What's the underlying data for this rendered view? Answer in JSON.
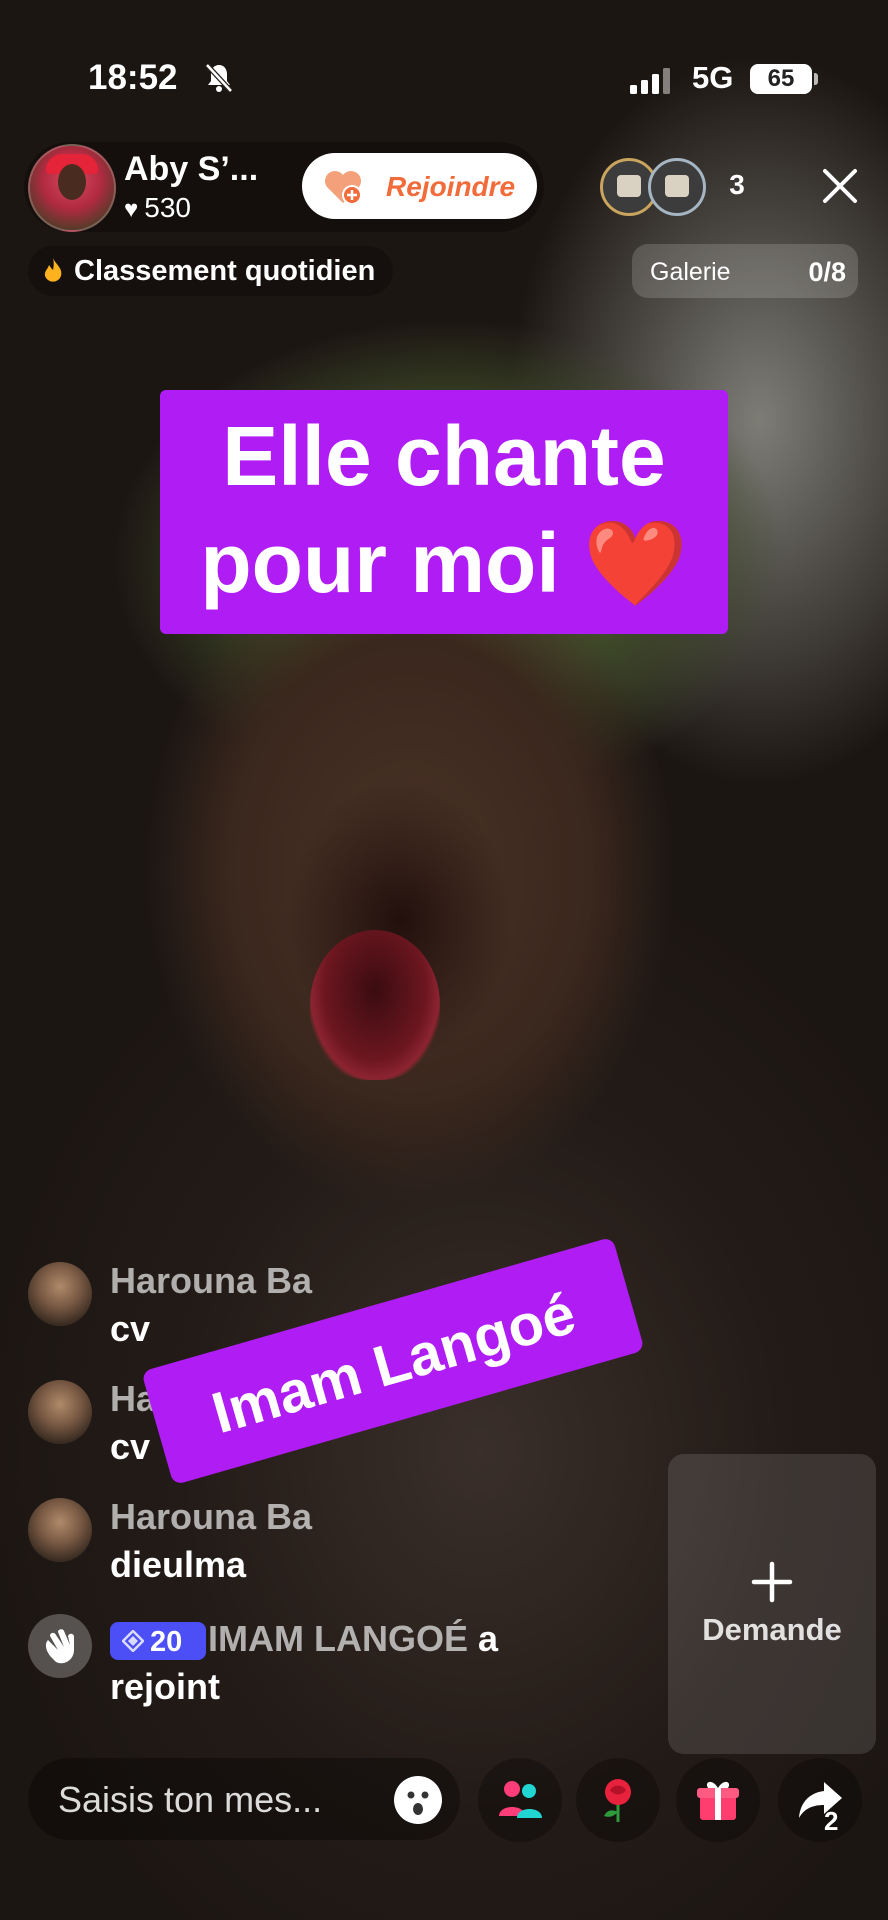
{
  "status_bar": {
    "time": "18:52",
    "network": "5G",
    "battery": "65"
  },
  "host": {
    "name": "Aby S’...",
    "likes": "530",
    "join_label": "Rejoindre"
  },
  "viewers": {
    "count": "3"
  },
  "ranking": {
    "label": "Classement quotidien"
  },
  "gallery": {
    "label": "Galerie",
    "value": "0/8"
  },
  "captions": {
    "main_line1": "Elle chante",
    "main_line2": "pour moi ❤️",
    "secondary": "Imam Langoé"
  },
  "comments": [
    {
      "name": "Harouna Ba",
      "text": "cv"
    },
    {
      "name": "Ha",
      "text": "cv"
    },
    {
      "name": "Harouna Ba",
      "text": "dieulma"
    }
  ],
  "join_event": {
    "badge_level": "20",
    "user": "IMAM LANGOÉ",
    "line1_suffix": "a",
    "line2": "rejoint"
  },
  "request_card": {
    "label": "Demande"
  },
  "bottom_bar": {
    "input_placeholder": "Saisis ton mes...",
    "share_count": "2"
  },
  "icons": [
    "bell-off-icon",
    "signal-icon",
    "heart-icon",
    "join-heart-icon",
    "seat-icon",
    "close-icon",
    "flame-icon",
    "wave-icon",
    "diamond-icon",
    "plus-icon",
    "emoji-icon",
    "guests-icon",
    "rose-icon",
    "gift-icon",
    "share-icon"
  ]
}
